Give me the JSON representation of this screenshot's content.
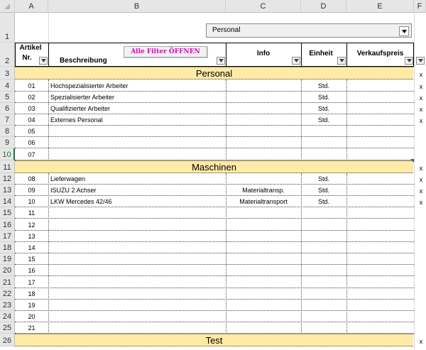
{
  "columns": [
    "A",
    "B",
    "C",
    "D",
    "E",
    "F"
  ],
  "dropdown": {
    "value": "Personal"
  },
  "filter_button": {
    "label": "Alle Filter ÖFFNEN"
  },
  "headers": {
    "artikel_line1": "Artikel",
    "artikel_line2": "Nr.",
    "beschreibung": "Beschreibung",
    "info": "Info",
    "einheit": "Einheit",
    "verkaufspreis": "Verkaufspreis"
  },
  "row_numbers": [
    "1",
    "2",
    "3",
    "4",
    "5",
    "6",
    "7",
    "8",
    "9",
    "10",
    "11",
    "12",
    "13",
    "14",
    "15",
    "16",
    "17",
    "18",
    "19",
    "20",
    "21",
    "22",
    "23",
    "24",
    "25",
    "26"
  ],
  "sections": [
    "Personal",
    "Maschinen",
    "Test"
  ],
  "x_mark": "x",
  "personal_rows": [
    {
      "nr": "01",
      "desc": "Hochspezialisierter Arbeiter",
      "info": "",
      "unit": "Std."
    },
    {
      "nr": "02",
      "desc": "Spezialisierter Arbeiter",
      "info": "",
      "unit": "Std."
    },
    {
      "nr": "03",
      "desc": "Qualifizierter Arbeiter",
      "info": "",
      "unit": "Std."
    },
    {
      "nr": "04",
      "desc": "Externes Personal",
      "info": "",
      "unit": "Std."
    },
    {
      "nr": "05",
      "desc": "",
      "info": "",
      "unit": ""
    },
    {
      "nr": "06",
      "desc": "",
      "info": "",
      "unit": ""
    },
    {
      "nr": "07",
      "desc": "",
      "info": "",
      "unit": ""
    }
  ],
  "maschinen_rows": [
    {
      "nr": "08",
      "desc": "Lieferwagen",
      "info": "",
      "unit": "Std."
    },
    {
      "nr": "09",
      "desc": "ISUZU 2 Achser",
      "info": "Materialtransp.",
      "unit": "Std."
    },
    {
      "nr": "10",
      "desc": "LKW Mercedes 42/46",
      "info": "Materialtransport",
      "unit": "Std."
    },
    {
      "nr": "11",
      "desc": "",
      "info": "",
      "unit": ""
    },
    {
      "nr": "12",
      "desc": "",
      "info": "",
      "unit": ""
    },
    {
      "nr": "13",
      "desc": "",
      "info": "",
      "unit": ""
    },
    {
      "nr": "14",
      "desc": "",
      "info": "",
      "unit": ""
    },
    {
      "nr": "15",
      "desc": "",
      "info": "",
      "unit": ""
    },
    {
      "nr": "16",
      "desc": "",
      "info": "",
      "unit": ""
    },
    {
      "nr": "17",
      "desc": "",
      "info": "",
      "unit": ""
    },
    {
      "nr": "18",
      "desc": "",
      "info": "",
      "unit": ""
    },
    {
      "nr": "19",
      "desc": "",
      "info": "",
      "unit": ""
    },
    {
      "nr": "20",
      "desc": "",
      "info": "",
      "unit": ""
    },
    {
      "nr": "21",
      "desc": "",
      "info": "",
      "unit": ""
    }
  ],
  "colors": {
    "band": "#ffeaa6",
    "filter_text": "#e000c8",
    "header_bg": "#e6e6e6"
  }
}
